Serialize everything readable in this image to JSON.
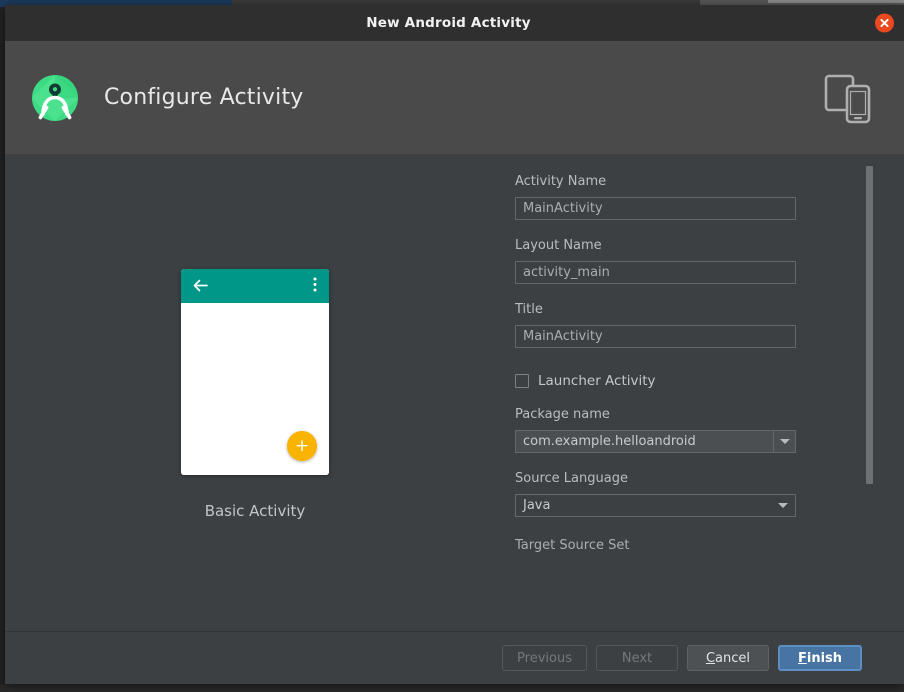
{
  "window": {
    "title": "New Android Activity",
    "close_icon": "close-circle-icon"
  },
  "header": {
    "title": "Configure Activity",
    "logo_icon": "android-studio-logo-icon",
    "device_icon": "tablet-and-phone-icon"
  },
  "preview": {
    "caption": "Basic Activity",
    "back_icon": "arrow-back-icon",
    "overflow_icon": "more-vert-icon",
    "fab_label": "+",
    "appbar_color": "#009688",
    "fab_color": "#f9b300",
    "screen_color": "#ffffff"
  },
  "form": {
    "fields": [
      {
        "label": "Activity Name",
        "value": "MainActivity",
        "type": "text"
      },
      {
        "label": "Layout Name",
        "value": "activity_main",
        "type": "text"
      },
      {
        "label": "Title",
        "value": "MainActivity",
        "type": "text"
      }
    ],
    "checkbox": {
      "label": "Launcher Activity",
      "checked": false
    },
    "package": {
      "label": "Package name",
      "value": "com.example.helloandroid",
      "dropdown_icon": "chevron-down-icon"
    },
    "language": {
      "label": "Source Language",
      "value": "Java",
      "dropdown_icon": "chevron-down-icon"
    },
    "clipped_label": "Target Source Set"
  },
  "footer": {
    "previous": "Previous",
    "next": "Next",
    "cancel_mnemonic": "C",
    "cancel_rest": "ancel",
    "finish_mnemonic": "F",
    "finish_rest": "inish"
  }
}
